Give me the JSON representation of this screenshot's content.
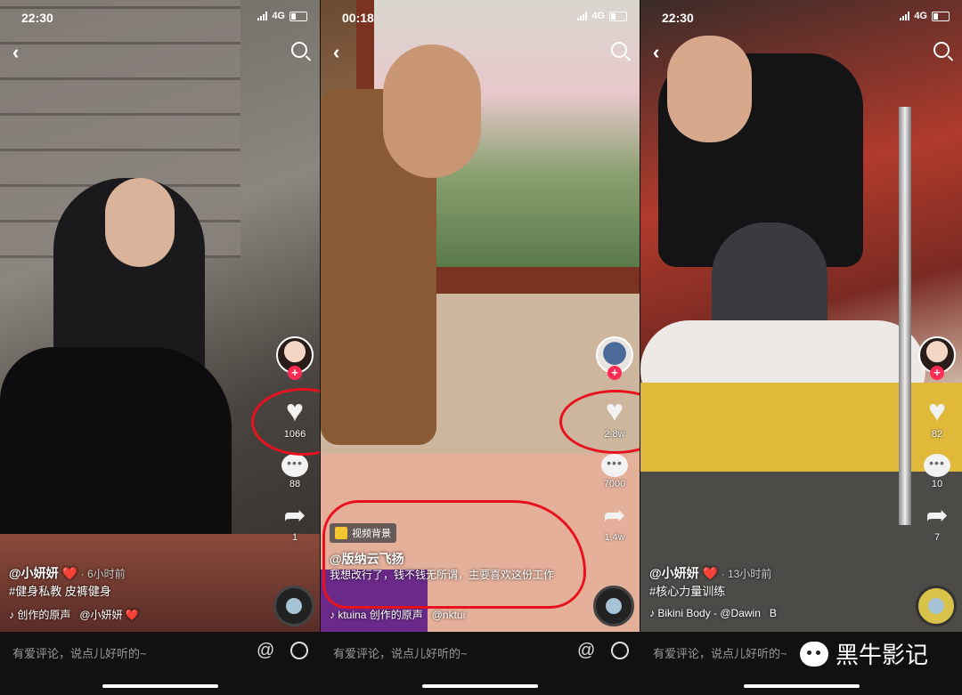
{
  "panels": [
    {
      "time": "22:30",
      "network": "4G",
      "likes": "1066",
      "comments": "88",
      "shares": "1",
      "user": "@小妍妍 ❤️",
      "posted": "· 6小时前",
      "text": "#健身私教 皮裤健身",
      "music": "创作的原声",
      "music_user": "@小妍妍 ❤️",
      "comment_placeholder": "有爱评论，说点儿好听的~"
    },
    {
      "time": "00:18",
      "network": "4G",
      "likes": "2.8w",
      "comments": "7000",
      "shares": "1.4w",
      "tag": "视频背景",
      "user": "@版纳云飞扬",
      "text": "我想改行了，钱不钱无所谓，主要喜欢这份工作",
      "music": "ktuina 创作的原声",
      "music_user": "@nktui",
      "comment_placeholder": "有爱评论，说点儿好听的~"
    },
    {
      "time": "22:30",
      "network": "4G",
      "likes": "82",
      "comments": "10",
      "shares": "7",
      "user": "@小妍妍 ❤️",
      "posted": "· 13小时前",
      "text": "#核心力量训练",
      "music": "Bikini Body - @Dawin",
      "music_user": "B",
      "comment_placeholder": "有爱评论，说点儿好听的~"
    }
  ],
  "watermark": "黑牛影记",
  "colors": {
    "annotation_red": "#e8121f",
    "follow_plus": "#fe2c55"
  },
  "icons": [
    "back-icon",
    "search-icon",
    "heart-icon",
    "comment-icon",
    "share-icon",
    "music-note-icon",
    "at-icon",
    "emoji-icon",
    "signal-icon",
    "battery-icon",
    "wechat-icon"
  ]
}
